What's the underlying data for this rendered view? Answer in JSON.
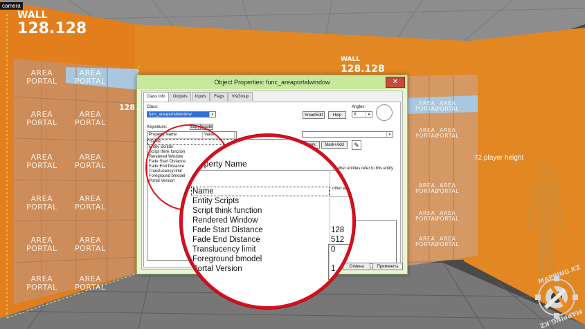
{
  "viewport": {
    "label": "camera"
  },
  "scene": {
    "walls": [
      {
        "title": "WALL",
        "value": "128.128"
      },
      {
        "title": "WALL",
        "value": "128.128"
      },
      {
        "title": "WALL",
        "value": "128.128"
      }
    ],
    "portal_label_line1": "AREA",
    "portal_label_line2": "PORTAL",
    "player_height": "72 player height",
    "small_wall_value": "128.128"
  },
  "dialog": {
    "title": "Object Properties: func_areaportalwindow",
    "close": "✕",
    "tabs": [
      "Class Info",
      "Outputs",
      "Inputs",
      "Flags",
      "VisGroup"
    ],
    "class_label": "Class:",
    "class_value": "func_areaportalwindow",
    "smartedit": "SmartEdit",
    "help": "Help",
    "angles_label": "Angles:",
    "angles_value": "0",
    "keyvalues_label": "Keyvalues:",
    "copy": "copy",
    "paste": "paste",
    "columns": {
      "name": "Property Name",
      "value": "Value"
    },
    "properties": [
      {
        "name": "Name",
        "value": ""
      },
      {
        "name": "Entity Scripts",
        "value": ""
      },
      {
        "name": "Script think function",
        "value": ""
      },
      {
        "name": "Rendered Window",
        "value": ""
      },
      {
        "name": "Fade Start Distance",
        "value": "128"
      },
      {
        "name": "Fade End Distance",
        "value": "512"
      },
      {
        "name": "Translucency limit",
        "value": "0"
      },
      {
        "name": "Foreground bmodel",
        "value": ""
      },
      {
        "name": "Portal Version",
        "value": "1"
      }
    ],
    "mark": "Mark",
    "mark_add": "Mark+Add",
    "help_text": "other entities refer to this entity",
    "cancel": "Отмена",
    "apply": "Применить"
  },
  "logo": {
    "line1": "MAPPING.KZ",
    "line2": "MAPPING.KZ"
  }
}
